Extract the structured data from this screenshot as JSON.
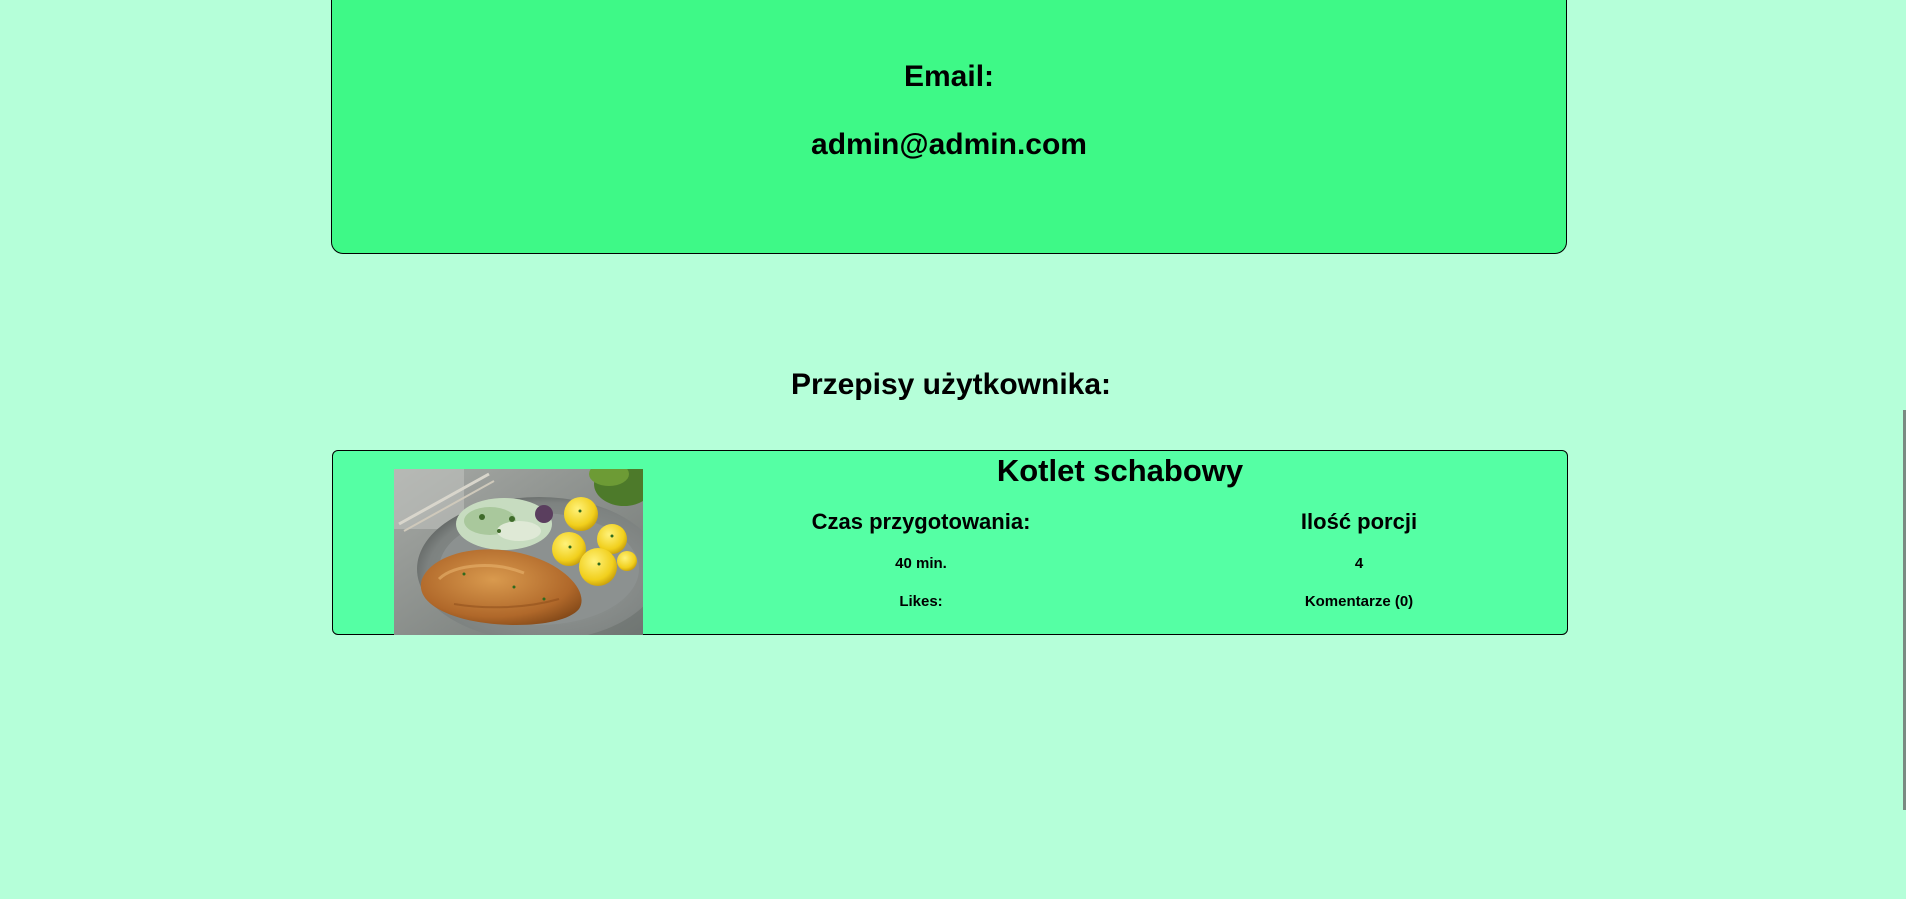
{
  "profile": {
    "email_label": "Email:",
    "email_value": "admin@admin.com"
  },
  "recipes_section": {
    "title": "Przepisy użytkownika:"
  },
  "recipes": [
    {
      "title": "Kotlet schabowy",
      "prep_time_label": "Czas przygotowania:",
      "prep_time_value": "40 min.",
      "likes_label": "Likes:",
      "servings_label": "Ilość porcji",
      "servings_value": "4",
      "comments_label": "Komentarze (0)"
    }
  ],
  "colors": {
    "background": "#b5ffd9",
    "profile_card": "#3ef987",
    "recipe_card": "#55ffa4"
  }
}
